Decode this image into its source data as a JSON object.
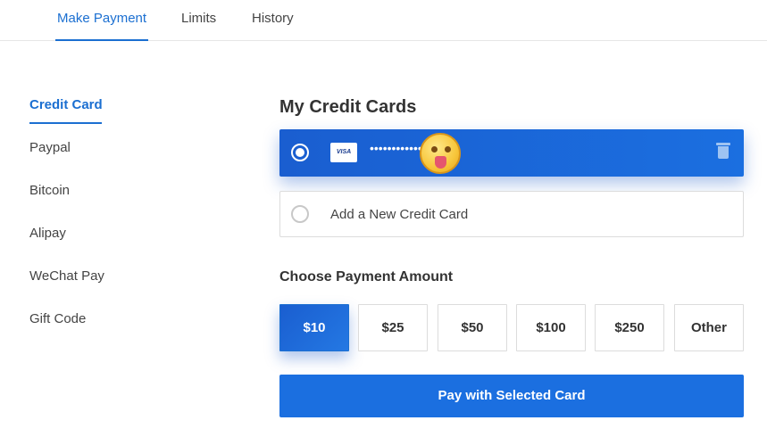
{
  "top_tabs": [
    {
      "label": "Make Payment"
    },
    {
      "label": "Limits"
    },
    {
      "label": "History"
    }
  ],
  "side_nav": [
    {
      "label": "Credit Card"
    },
    {
      "label": "Paypal"
    },
    {
      "label": "Bitcoin"
    },
    {
      "label": "Alipay"
    },
    {
      "label": "WeChat Pay"
    },
    {
      "label": "Gift Code"
    }
  ],
  "cards": {
    "title": "My Credit Cards",
    "saved": {
      "brand": "VISA",
      "masked_number": "••••••••••••",
      "icon": "tongue-emoji-sticker",
      "delete_icon": "trash-icon"
    },
    "add_new_label": "Add a New Credit Card"
  },
  "amounts": {
    "title": "Choose Payment Amount",
    "options": [
      "$10",
      "$25",
      "$50",
      "$100",
      "$250",
      "Other"
    ],
    "selected": "$10"
  },
  "pay_button_label": "Pay with Selected Card",
  "colors": {
    "accent": "#1b6fd1",
    "button": "#1b6fe0"
  }
}
